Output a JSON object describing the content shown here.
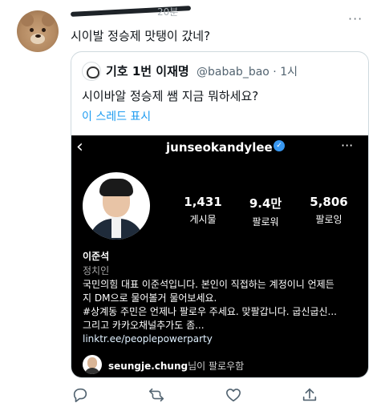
{
  "tweet": {
    "time": "20분",
    "text": "시이발 정승제 맛탱이 갔네?"
  },
  "quoted_tweet": {
    "display_name": "기호 1번 이재명",
    "handle_time": "@babab_bao · 1시",
    "text": "시이바알 정승제 쌤 지금 뭐하세요?",
    "show_thread": "이 스레드 표시"
  },
  "instagram": {
    "back_icon": "chevron-left-icon",
    "username": "junseokandylee",
    "more_icon": "more-horizontal-icon",
    "stats": [
      {
        "value": "1,431",
        "label": "게시물"
      },
      {
        "value": "9.4만",
        "label": "팔로워"
      },
      {
        "value": "5,806",
        "label": "팔로잉"
      }
    ],
    "name": "이준석",
    "category": "정치인",
    "bio": [
      "국민의힘 대표 이준석입니다. 본인이 직접하는 계정이니 언제든",
      "지 DM으로 물어볼거 물어보세요.",
      "#상계동 주민은 언제나 팔로우 주세요. 맞팔갑니다. 굽신굽신...",
      "그리고 카카오채널추가도 좀..."
    ],
    "link": "linktr.ee/peoplepowerparty",
    "followed_by_user": "seungje.chung",
    "followed_by_suffix": "님이 팔로우함"
  },
  "actions": {
    "reply_icon": "reply-icon",
    "retweet_icon": "retweet-icon",
    "like_icon": "heart-icon",
    "share_icon": "share-icon"
  },
  "colors": {
    "link_blue": "#1d9bf0",
    "verified_blue": "#3897f0",
    "muted_gray": "#536471"
  }
}
